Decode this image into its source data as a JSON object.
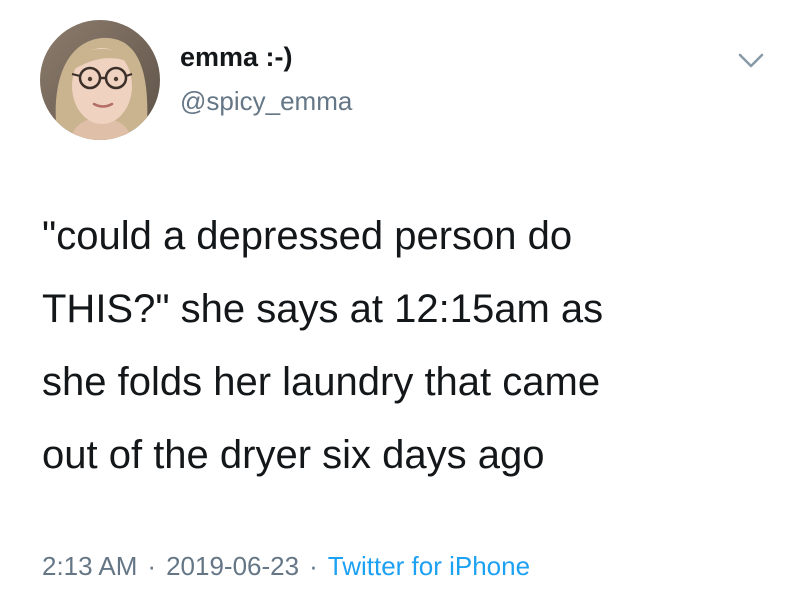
{
  "author": {
    "display_name": "emma :-)",
    "handle": "@spicy_emma"
  },
  "tweet": {
    "lines": [
      "\"could a depressed person do",
      "THIS?\" she says at 12:15am as",
      "she folds her laundry that came",
      "out of the dryer six days ago"
    ],
    "time": "2:13 AM",
    "date": "2019-06-23",
    "separator": "·",
    "source": "Twitter for iPhone"
  },
  "icons": {
    "menu": "chevron-down-icon"
  },
  "colors": {
    "text": "#14171a",
    "secondary": "#657786",
    "link": "#1da1f2"
  }
}
